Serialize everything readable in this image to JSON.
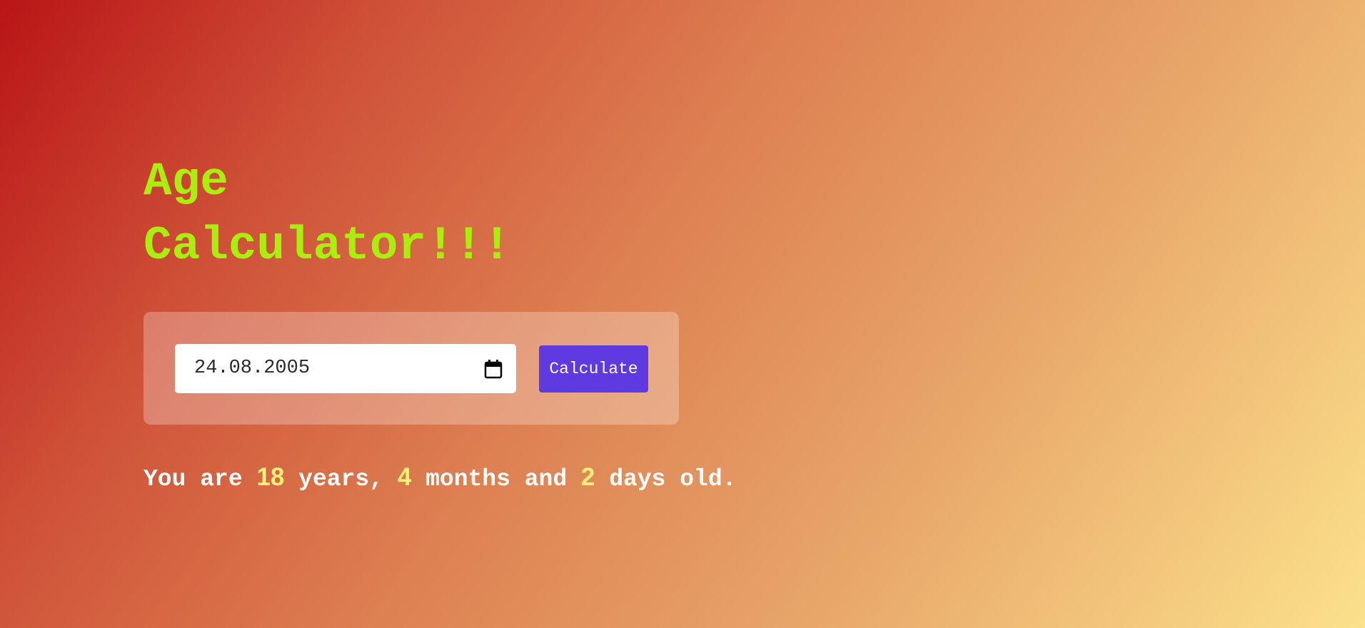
{
  "title": {
    "line1": "Age",
    "line2": "Calculator!!!"
  },
  "form": {
    "date_value": "24.08.2005",
    "calendar_icon": "calendar-icon",
    "button_label": "Calculate"
  },
  "result": {
    "prefix": "You are ",
    "years": "18",
    "years_text": " years, ",
    "months": "4",
    "months_text": " months and ",
    "days": "2",
    "days_text": " days old."
  },
  "colors": {
    "title": "#a8f00c",
    "button": "#5f3ae0",
    "highlight_numbers": "#fbf07a",
    "gradient_start": "#b91517",
    "gradient_end": "#fbe18c"
  }
}
